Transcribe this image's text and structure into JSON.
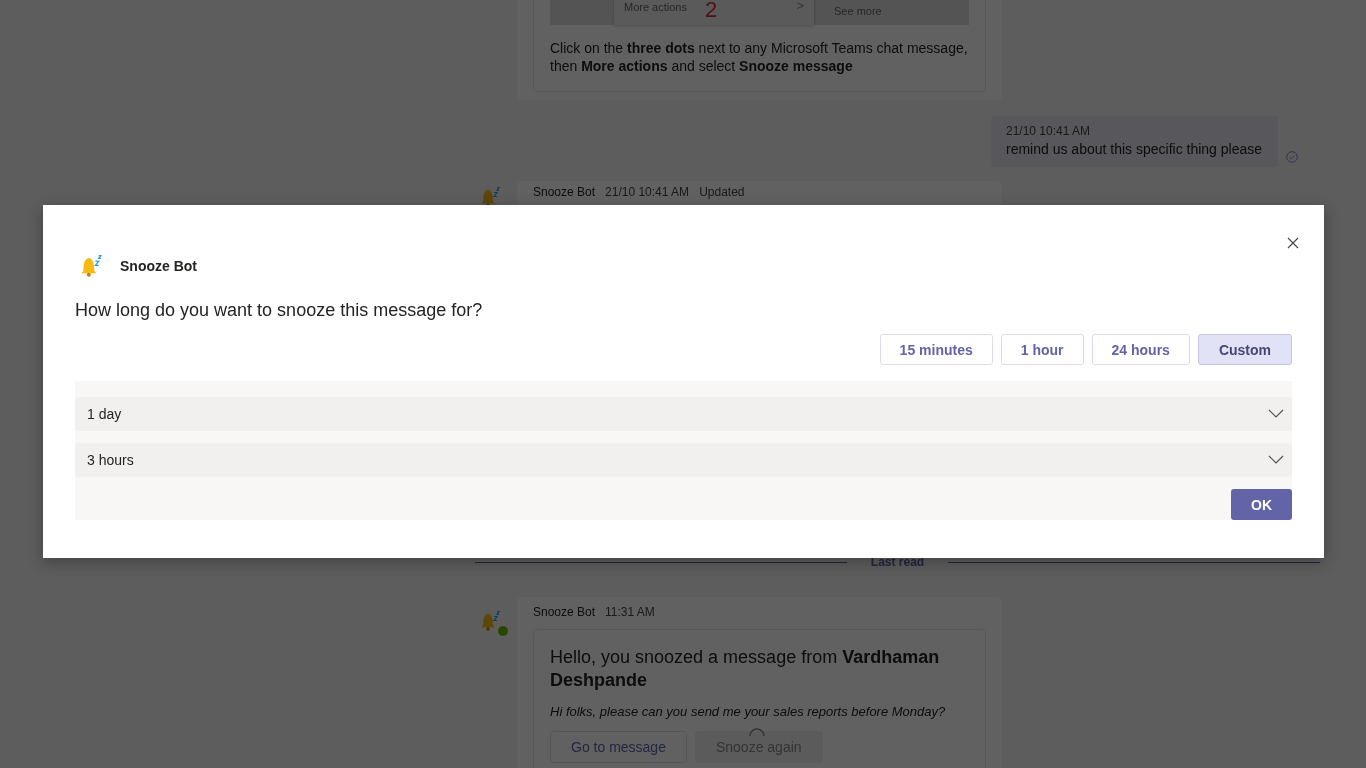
{
  "chat": {
    "top_card": {
      "image": {
        "menu_item": "More actions",
        "step": "2",
        "caret": ">",
        "side_link": "See more"
      },
      "instructions": "Click on the **three dots** next to any Microsoft Teams chat message, then **More actions** and select **Snooze message**"
    },
    "sent_message": {
      "time": "21/10 10:41 AM",
      "text": "remind us about this specific thing please",
      "read": true
    },
    "hidden_message": {
      "sender": "Snooze Bot",
      "time": "21/10 10:41 AM",
      "status": "Updated"
    },
    "divider": "Last read",
    "bot_message": {
      "sender": "Snooze Bot",
      "time": "11:31 AM",
      "online": true,
      "card": {
        "title": "Hello, you snoozed a message from **Vardhaman Deshpande**",
        "quote": "Hi folks, please can you send me your sales reports before Monday?",
        "buttons": [
          {
            "label": "Go to message",
            "disabled": false,
            "loading": false
          },
          {
            "label": "Snooze again",
            "disabled": true,
            "loading": true
          }
        ]
      }
    }
  },
  "dialog": {
    "bot_name": "Snooze Bot",
    "question": "How long do you want to snooze this message for?",
    "options": [
      {
        "label": "15 minutes",
        "selected": false
      },
      {
        "label": "1 hour",
        "selected": false
      },
      {
        "label": "24 hours",
        "selected": false
      },
      {
        "label": "Custom",
        "selected": true
      }
    ],
    "dropdowns": [
      {
        "value": "1 day"
      },
      {
        "value": "3 hours"
      }
    ],
    "confirm": "OK"
  }
}
